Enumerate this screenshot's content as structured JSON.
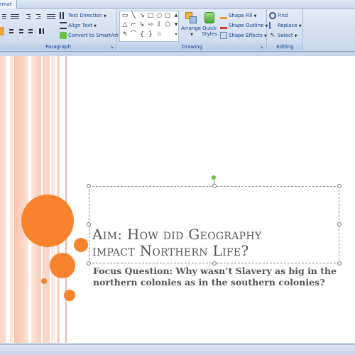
{
  "ribbon": {
    "active_tab": "rmat",
    "groups": {
      "paragraph": {
        "label": "Paragraph"
      },
      "drawing": {
        "label": "Drawing"
      },
      "editing": {
        "label": "Editing"
      }
    },
    "text_direction_label": "Text Direction",
    "align_text_label": "Align Text",
    "convert_smartart_label": "Convert to SmartArt",
    "arrange_label": "Arrange",
    "quick_styles_label": "Quick Styles",
    "shape_fill_label": "Shape Fill",
    "shape_outline_label": "Shape Outline",
    "shape_effects_label": "Shape Effects",
    "find_label": "Find",
    "replace_label": "Replace",
    "select_label": "Select"
  },
  "slide": {
    "title_line1": "Aim:  How did Geography",
    "title_line2": "impact Northern Life?",
    "subtitle_line1": "Focus Question:  Why wasn’t Slavery as big in the",
    "subtitle_line2": "northern colonies as in the southern colonies?"
  },
  "colors": {
    "accent_orange": "#f7832e",
    "stripe_pink": "#f9c9b6",
    "title_gray": "#555555",
    "ribbon_text": "#15428b"
  }
}
